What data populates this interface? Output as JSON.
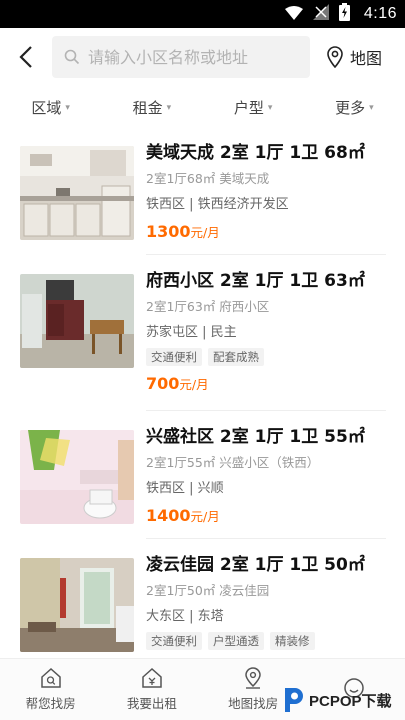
{
  "status_bar": {
    "time": "4:16"
  },
  "search": {
    "placeholder": "请输入小区名称或地址"
  },
  "map_button": {
    "label": "地图"
  },
  "filters": [
    {
      "label": "区域"
    },
    {
      "label": "租金"
    },
    {
      "label": "户型"
    },
    {
      "label": "更多"
    }
  ],
  "listings": [
    {
      "title": "美域天成 2室 1厅 1卫 68㎡",
      "sub": "2室1厅68㎡  美域天成",
      "location": "铁西区 | 铁西经济开发区",
      "tags": [],
      "price": "1300",
      "price_unit": "元/月"
    },
    {
      "title": "府西小区 2室 1厅 1卫 63㎡",
      "sub": "2室1厅63㎡  府西小区",
      "location": "苏家屯区 | 民主",
      "tags": [
        "交通便利",
        "配套成熟"
      ],
      "price": "700",
      "price_unit": "元/月"
    },
    {
      "title": "兴盛社区 2室 1厅 1卫 55㎡",
      "sub": "2室1厅55㎡  兴盛小区（铁西）",
      "location": "铁西区 | 兴顺",
      "tags": [],
      "price": "1400",
      "price_unit": "元/月"
    },
    {
      "title": "凌云佳园 2室 1厅 1卫 50㎡",
      "sub": "2室1厅50㎡  凌云佳园",
      "location": "大东区 | 东塔",
      "tags": [
        "交通便利",
        "户型通透",
        "精装修"
      ],
      "price": "",
      "price_unit": ""
    }
  ],
  "bottom_nav": [
    {
      "label": "帮您找房",
      "icon": "house-search-icon"
    },
    {
      "label": "我要出租",
      "icon": "house-rent-icon"
    },
    {
      "label": "地图找房",
      "icon": "map-pin-icon"
    },
    {
      "label": "",
      "icon": "profile-icon"
    }
  ],
  "watermark": {
    "text": "PCPOP下载"
  },
  "colors": {
    "accent": "#ff6a00",
    "tag_bg": "#f2f2f2"
  }
}
